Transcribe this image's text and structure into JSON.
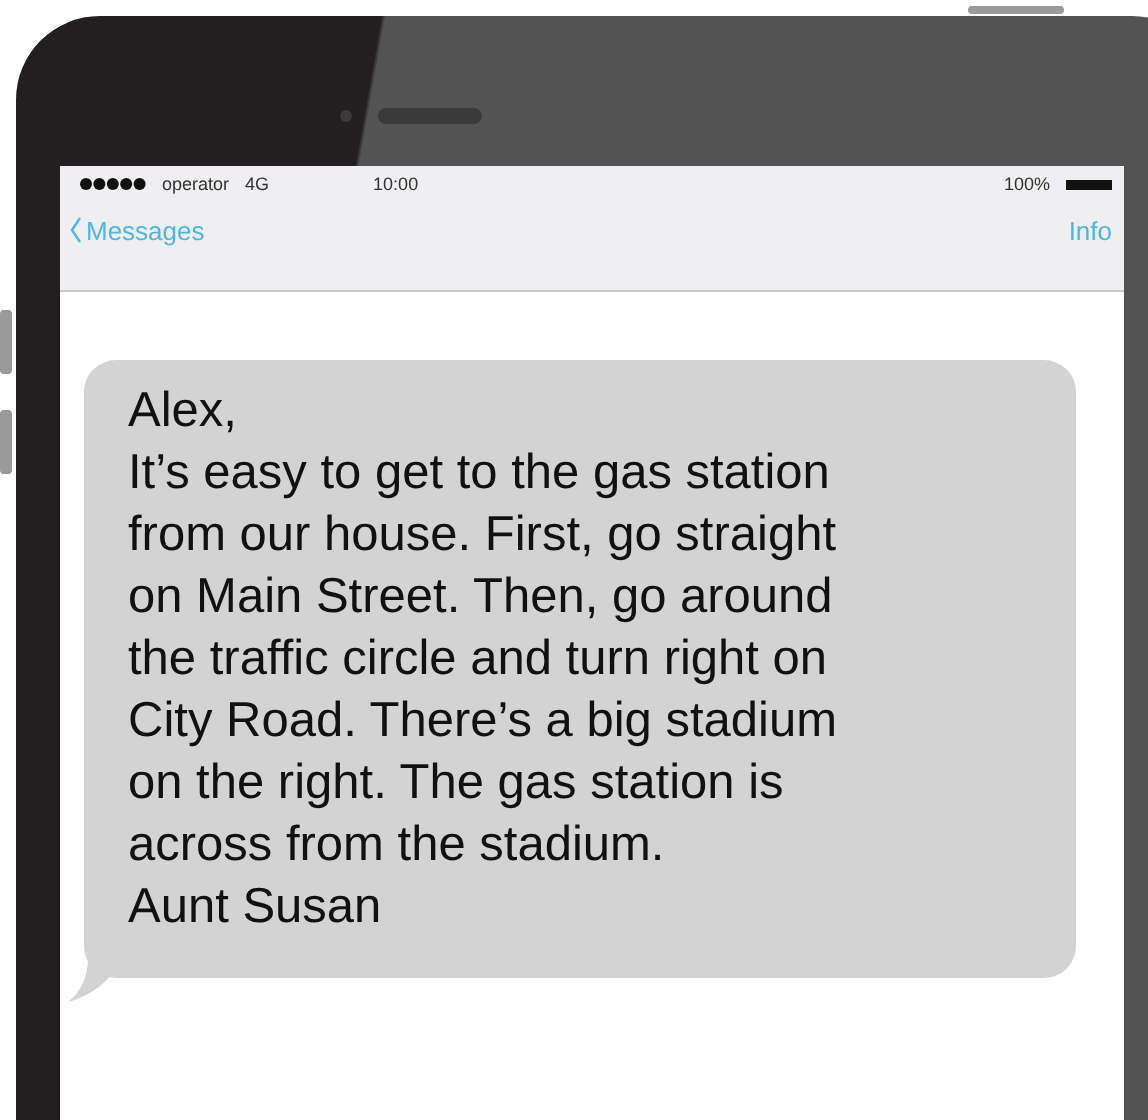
{
  "status_bar": {
    "carrier": "operator",
    "network": "4G",
    "time": "10:00",
    "battery": "100%"
  },
  "nav": {
    "back": "Messages",
    "action": "Info"
  },
  "message": {
    "lines": [
      "Alex,",
      "It’s easy to get to the gas station",
      "from our house. First, go straight",
      "on Main Street. Then, go around",
      "the traffic circle and turn right on",
      "City Road. There’s a big stadium",
      "on the right. The gas station is",
      "across from the stadium.",
      "Aunt Susan"
    ]
  }
}
